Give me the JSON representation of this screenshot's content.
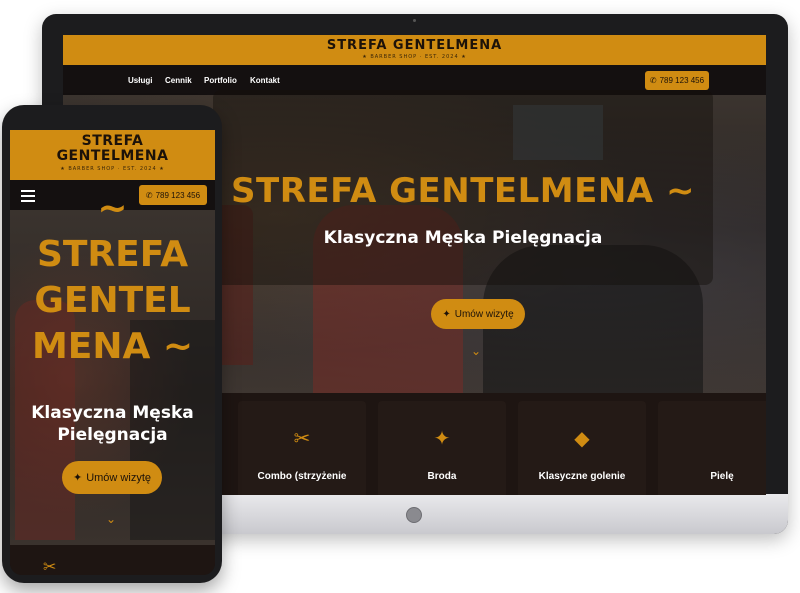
{
  "site": {
    "brand": "STREFA GENTELMENA",
    "tagline": "★ BARBER SHOP · EST. 2024 ★",
    "phone": "789 123 456",
    "accent_color": "#d08c12"
  },
  "desktop": {
    "nav": [
      "Usługi",
      "Cennik",
      "Portfolio",
      "Kontakt"
    ],
    "hero_title": "STREFA GENTELMENA ~",
    "hero_subtitle": "Klasyczna Męska Pielęgnacja",
    "cta": "Umów wizytę",
    "services": [
      {
        "icon": "scissors-icon",
        "label": "Combo (strzyżenie"
      },
      {
        "icon": "sparkles-icon",
        "label": "Broda"
      },
      {
        "icon": "diamond-icon",
        "label": "Klasyczne golenie"
      },
      {
        "icon": "",
        "label": "Pielę"
      }
    ]
  },
  "mobile": {
    "brand_line1": "STREFA",
    "brand_line2": "GENTELMENA",
    "tagline": "★ BARBER SHOP · EST. 2024 ★",
    "phone": "789 123 456",
    "hero_prefix": "~",
    "hero_line1": "STREFA",
    "hero_line2": "GENTEL",
    "hero_line3": "MENA ~",
    "hero_sub1": "Klasyczna Męska",
    "hero_sub2": "Pielęgnacja",
    "cta": "Umów wizytę"
  }
}
